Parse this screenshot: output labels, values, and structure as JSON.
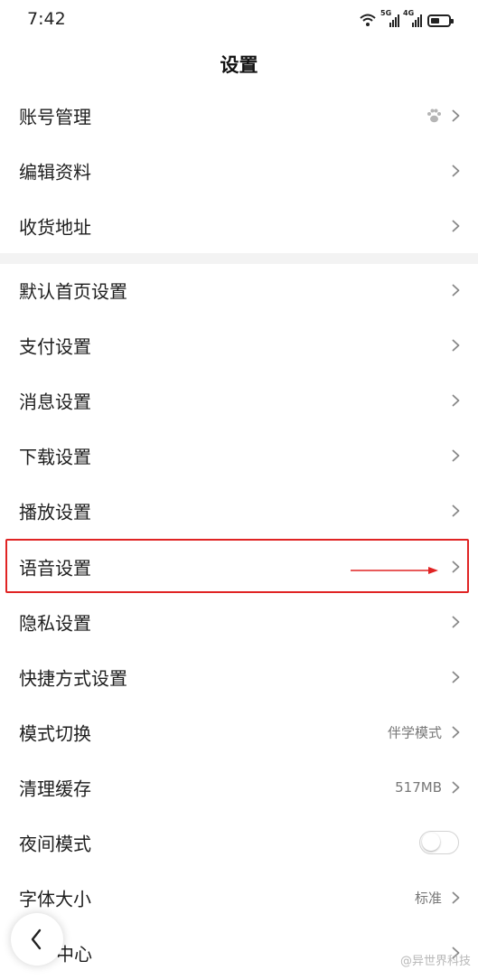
{
  "status_bar": {
    "time": "7:42",
    "signal1_label": "5G",
    "signal2_label": "4G"
  },
  "header": {
    "title": "设置"
  },
  "group1": [
    {
      "label": "账号管理",
      "icon": "paw-icon"
    },
    {
      "label": "编辑资料"
    },
    {
      "label": "收货地址"
    }
  ],
  "group2": [
    {
      "label": "默认首页设置"
    },
    {
      "label": "支付设置"
    },
    {
      "label": "消息设置"
    },
    {
      "label": "下载设置"
    },
    {
      "label": "播放设置"
    },
    {
      "label": "语音设置"
    },
    {
      "label": "隐私设置"
    },
    {
      "label": "快捷方式设置"
    },
    {
      "label": "模式切换",
      "value": "伴学模式"
    },
    {
      "label": "清理缓存",
      "value": "517MB"
    },
    {
      "label": "夜间模式"
    },
    {
      "label": "字体大小",
      "value": "标准"
    },
    {
      "label": "中心"
    }
  ],
  "watermark": "@异世界科技",
  "colors": {
    "highlight": "#e02424",
    "section_gap": "#f3f3f3",
    "secondary_text": "#777777"
  }
}
